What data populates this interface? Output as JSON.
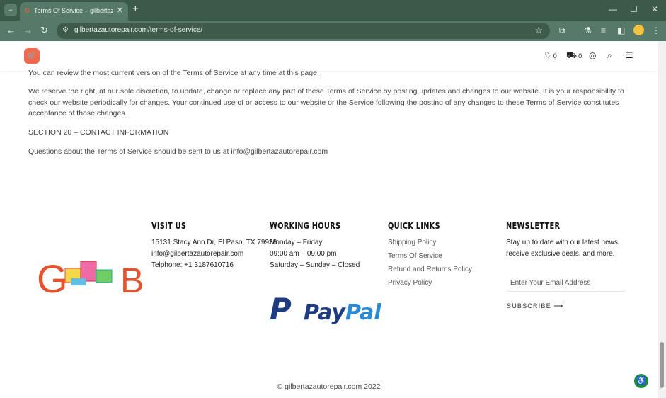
{
  "browser": {
    "tab_title": "Terms Of Service – gilbertazautorepair",
    "url": "gilbertazautorepair.com/terms-of-service/",
    "accent_color": "#3c5a4a"
  },
  "header": {
    "wishlist_count": "0",
    "cart_count": "0"
  },
  "content": {
    "p1": "You can review the most current version of the Terms of Service at any time at this page.",
    "p2": "We reserve the right, at our sole discretion, to update, change or replace any part of these Terms of Service by posting updates and changes to our website. It is your responsibility to check our website periodically for changes. Your continued use of or access to our website or the Service following the posting of any changes to these Terms of Service constitutes acceptance of those changes.",
    "section_heading": "SECTION 20 – CONTACT INFORMATION",
    "p3": "Questions about the Terms of Service should be sent to us at info@gilbertazautorepair.com"
  },
  "footer": {
    "logo_text": "GB",
    "visit": {
      "title": "VISIT US",
      "address": "15131 Stacy Ann Dr, El Paso, TX 79938",
      "email": "info@gilbertazautorepair.com",
      "phone": "Telphone: +1 3187610716"
    },
    "hours": {
      "title": "WORKING HOURS",
      "line1": "Monday – Friday",
      "line2": "09:00 am – 09:00 pm",
      "line3": "Saturday – Sunday – Closed"
    },
    "paypal_text": "PayPal",
    "links": {
      "title": "QUICK LINKS",
      "items": [
        "Shipping Policy",
        "Terms Of Service",
        "Refund and Returns Policy",
        "Privacy Policy"
      ]
    },
    "newsletter": {
      "title": "NEWSLETTER",
      "description": "Stay up to date with our latest news, receive exclusive deals, and more.",
      "placeholder": "Enter Your Email Address",
      "button": "SUBSCRIBE ⟶"
    },
    "copyright": "© gilbertazautorepair.com 2022"
  }
}
